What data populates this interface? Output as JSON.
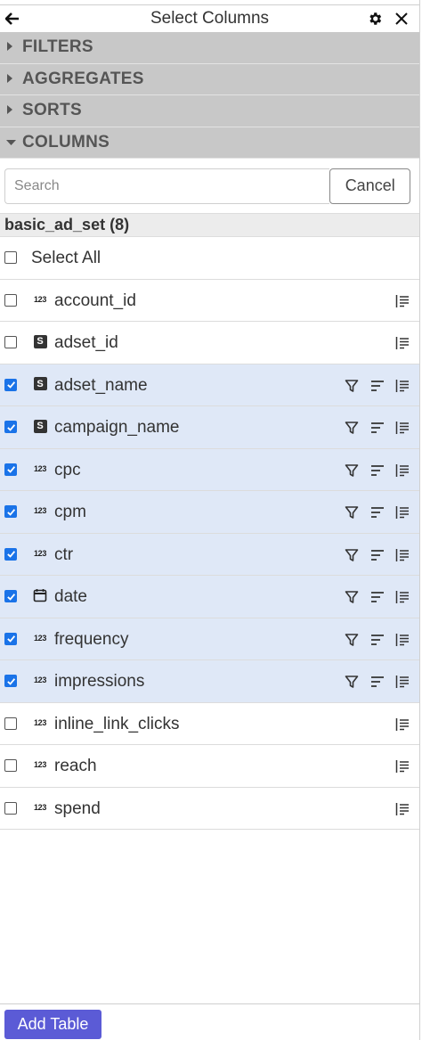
{
  "header": {
    "title": "Select Columns"
  },
  "sections": [
    {
      "label": "FILTERS",
      "expanded": false
    },
    {
      "label": "AGGREGATES",
      "expanded": false
    },
    {
      "label": "SORTS",
      "expanded": false
    },
    {
      "label": "COLUMNS",
      "expanded": true
    }
  ],
  "search": {
    "placeholder": "Search",
    "value": "",
    "cancel_label": "Cancel"
  },
  "group": {
    "title": "basic_ad_set (8)"
  },
  "select_all": {
    "label": "Select All",
    "checked": false
  },
  "columns": [
    {
      "name": "account_id",
      "type": "number",
      "checked": false
    },
    {
      "name": "adset_id",
      "type": "string",
      "checked": false
    },
    {
      "name": "adset_name",
      "type": "string",
      "checked": true
    },
    {
      "name": "campaign_name",
      "type": "string",
      "checked": true
    },
    {
      "name": "cpc",
      "type": "number",
      "checked": true
    },
    {
      "name": "cpm",
      "type": "number",
      "checked": true
    },
    {
      "name": "ctr",
      "type": "number",
      "checked": true
    },
    {
      "name": "date",
      "type": "date",
      "checked": true
    },
    {
      "name": "frequency",
      "type": "number",
      "checked": true
    },
    {
      "name": "impressions",
      "type": "number",
      "checked": true
    },
    {
      "name": "inline_link_clicks",
      "type": "number",
      "checked": false
    },
    {
      "name": "reach",
      "type": "number",
      "checked": false
    },
    {
      "name": "spend",
      "type": "number",
      "checked": false
    }
  ],
  "type_icons": {
    "number": "123",
    "string": "S",
    "date": "calendar-icon"
  },
  "footer": {
    "add_table_label": "Add Table"
  },
  "colors": {
    "section_bg": "#c8c8c8",
    "selected_row_bg": "#dfe8f7",
    "checkbox_checked": "#1a73e8",
    "add_button_bg": "#5b5bd6"
  }
}
